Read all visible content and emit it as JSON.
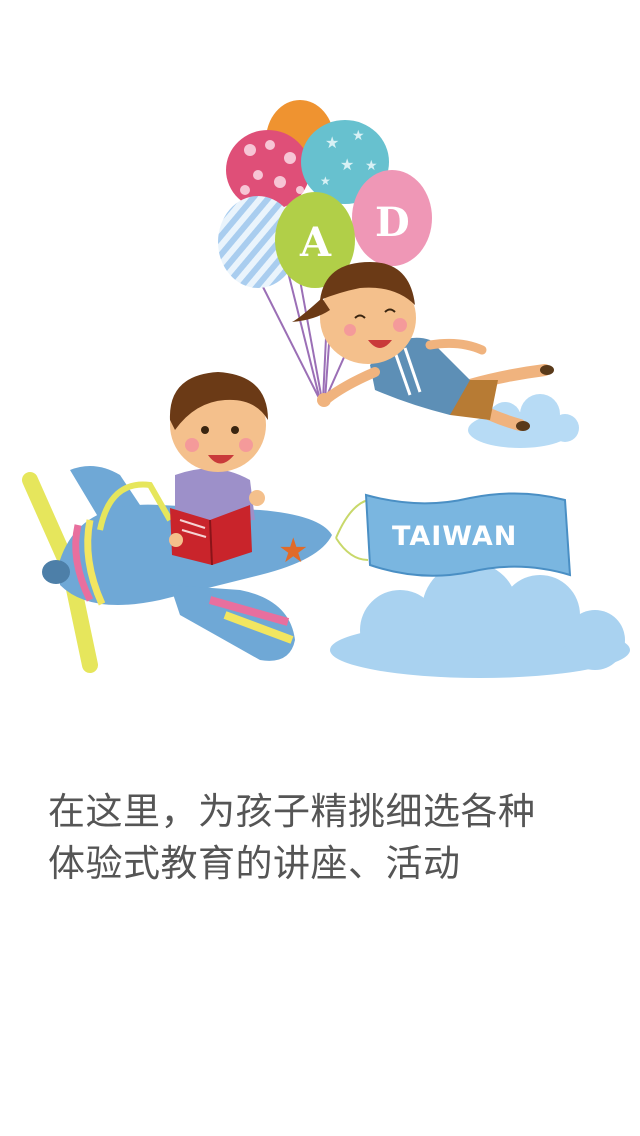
{
  "illustration": {
    "balloon_letters": [
      "A",
      "D"
    ],
    "banner_text": "TAIWAN"
  },
  "caption": {
    "line1": "在这里，为孩子精挑细选各种",
    "line2": "体验式教育的讲座、活动"
  },
  "colors": {
    "caption_text": "#555555",
    "banner_fill": "#7ab6e0",
    "banner_text": "#ffffff",
    "cloud": "#a9d2f0",
    "plane_body": "#6fa8d6",
    "book": "#c9242b"
  }
}
